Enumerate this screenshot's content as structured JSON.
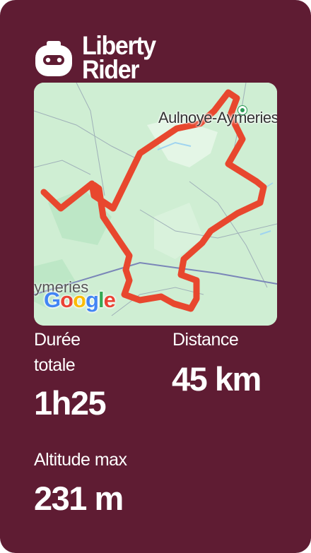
{
  "brand": {
    "name": "Liberty\nRider"
  },
  "map": {
    "town_label": "Aulnoye-Aymeries",
    "town_left_label": "Aymeries",
    "google_letters": [
      {
        "char": "G",
        "color": "#4285F4"
      },
      {
        "char": "o",
        "color": "#EA4335"
      },
      {
        "char": "o",
        "color": "#FBBC05"
      },
      {
        "char": "g",
        "color": "#4285F4"
      },
      {
        "char": "l",
        "color": "#34A853"
      },
      {
        "char": "e",
        "color": "#EA4335"
      }
    ],
    "route_color": "#e8472e",
    "water_color": "#bfe3f6",
    "land_color": "#cfeed3"
  },
  "stats": {
    "duration_label": "Durée\ntotale",
    "duration_value": "1h25",
    "distance_label": "Distance",
    "distance_value": "45 km",
    "altitude_label": "Altitude max",
    "altitude_value": "231 m"
  },
  "colors": {
    "background": "#5f1c33",
    "text": "#ffffff"
  }
}
